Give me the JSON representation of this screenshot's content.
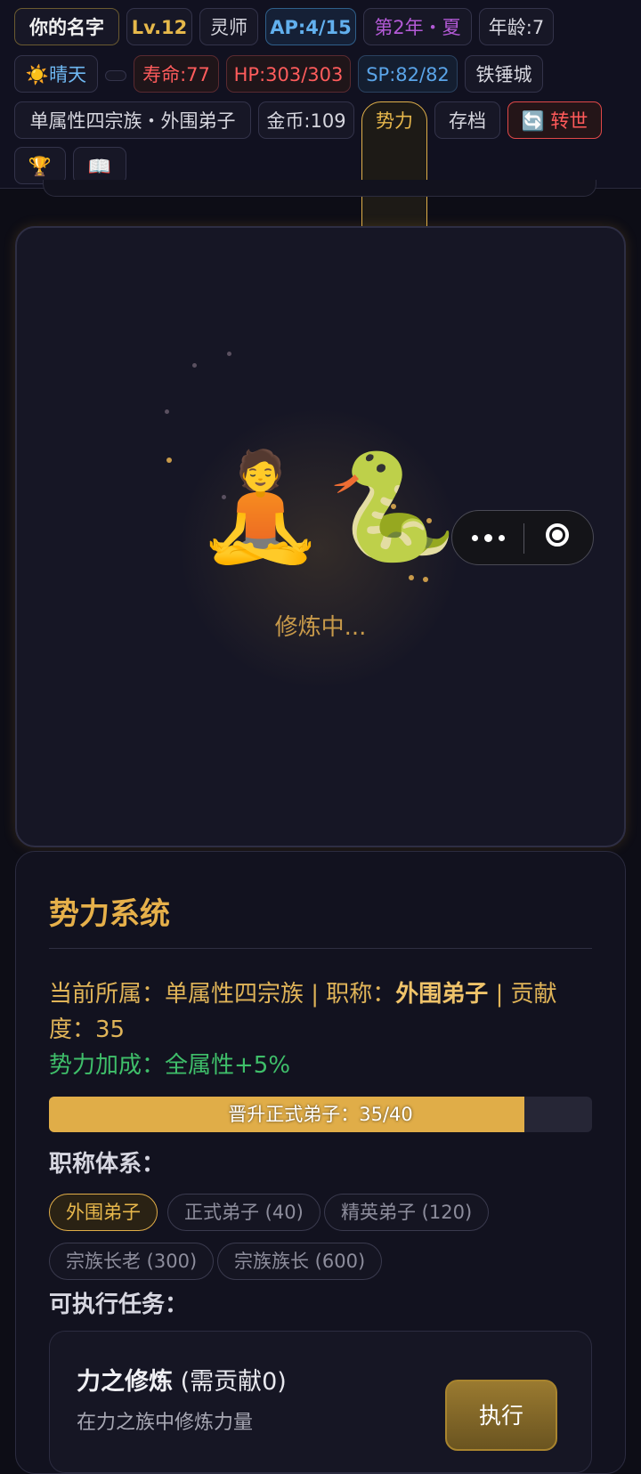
{
  "topbar": {
    "name": "你的名字",
    "level": "Lv.12",
    "rank": "灵师",
    "ap": "AP:4/15",
    "season": "第2年・夏",
    "age": "年龄:7",
    "weather": "☀️晴天",
    "lifespan": "寿命:77",
    "hp": "HP:303/303",
    "sp": "SP:82/82",
    "location": "铁锤城",
    "affiliation": "单属性四宗族・外围弟子",
    "gold": "金币:109",
    "faction_button": "势力",
    "save_button": "存档",
    "rebirth_button": "🔄 转世",
    "trophy_icon": "🏆",
    "book_icon": "📖"
  },
  "cultivation": {
    "avatar_emoji": "🧘",
    "beast_emoji": "🐍",
    "status": "修炼中..."
  },
  "faction_panel": {
    "title": "势力系统",
    "info_prefix": "当前所属：单属性四宗族 | 职称：",
    "title_rank": "外围弟子",
    "info_suffix": " | 贡献度：35",
    "bonus": "势力加成：全属性+5%",
    "progress_label": "晋升正式弟子：35/40",
    "progress_value": 35,
    "progress_max": 40,
    "ranks_heading": "职称体系：",
    "ranks": [
      "外围弟子",
      "正式弟子 (40)",
      "精英弟子 (120)",
      "宗族长老 (300)",
      "宗族族长 (600)"
    ],
    "tasks_heading": "可执行任务：",
    "task": {
      "name": "力之修炼",
      "requirement": " (需贡献0)",
      "description": "在力之族中修炼力量",
      "button": "执行"
    }
  },
  "colors": {
    "accent_gold": "#e0ad48",
    "hp_red": "#ff5c5c",
    "mp_blue": "#62b0ee",
    "bonus_green": "#3fbf6a"
  }
}
